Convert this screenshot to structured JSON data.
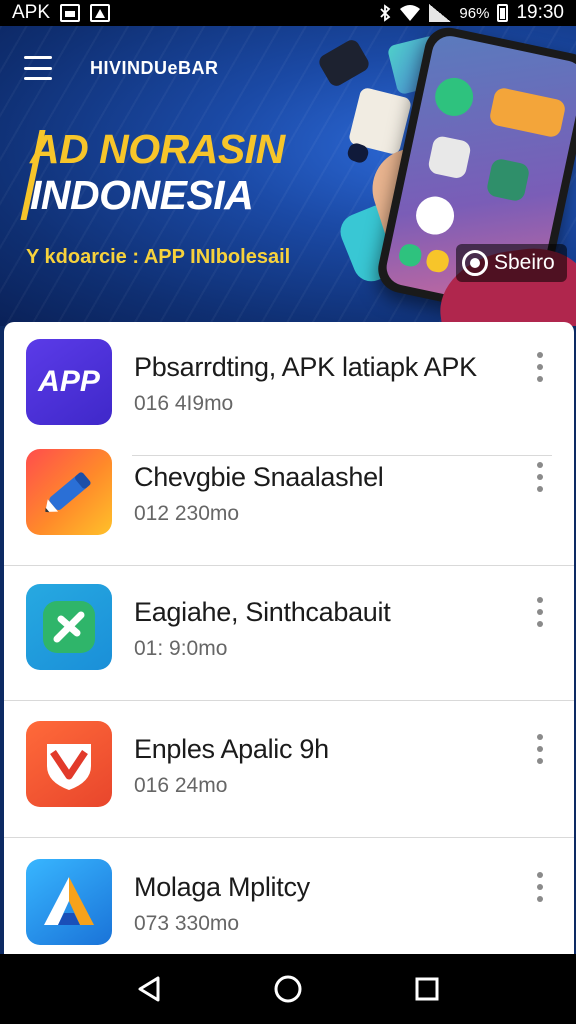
{
  "status_bar": {
    "carrier": "APK",
    "percent": "96%",
    "time": "19:30"
  },
  "banner": {
    "brand": "HIVINDUeBAR",
    "headline_line1": "AD NORASIN",
    "headline_line2": "INDONESIA",
    "subline": "Y kdoarcie : APP INIbolesail",
    "tag_label": "Sbeiro"
  },
  "apps": [
    {
      "name": "Pbsarrdting, APK latiapk APK",
      "size": "016 4I9mo",
      "icon": "app-text-icon",
      "icon_text": "APP"
    },
    {
      "name": "Chevgbie Snaalashel",
      "size": "012 230mo",
      "icon": "pencil-icon"
    },
    {
      "name": "Eagiahe, Sinthcabauit",
      "size": "01: 9:0mo",
      "icon": "check-icon"
    },
    {
      "name": "Enples Apalic 9h",
      "size": "016 24mo",
      "icon": "shield-icon"
    },
    {
      "name": "Molaga Mplitcy",
      "size": "073 330mo",
      "icon": "letter-a-icon"
    }
  ],
  "colors": {
    "accent_yellow": "#f7c52a",
    "banner_blue": "#1b4aa6",
    "list_bg": "#ffffff"
  }
}
